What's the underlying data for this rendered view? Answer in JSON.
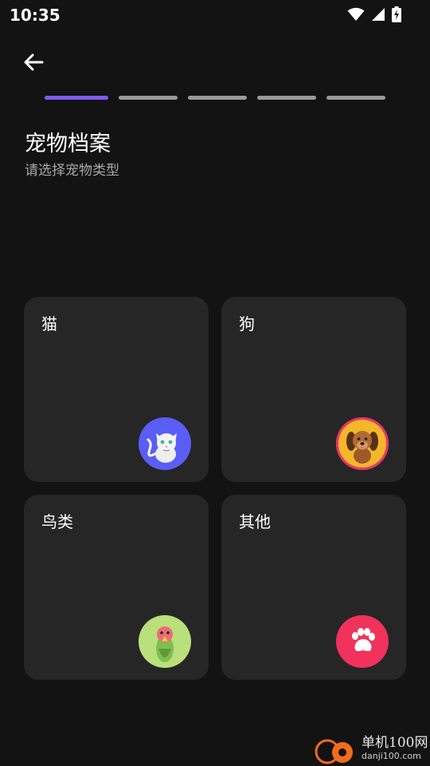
{
  "status_bar": {
    "time": "10:35"
  },
  "header": {
    "title": "宠物档案",
    "subtitle": "请选择宠物类型"
  },
  "progress": {
    "total_steps": 5,
    "current_step": 1
  },
  "pet_types": [
    {
      "label": "猫",
      "icon": "cat-icon",
      "icon_bg": "#5a5ef5"
    },
    {
      "label": "狗",
      "icon": "dog-icon",
      "icon_bg": "#f5b72a"
    },
    {
      "label": "鸟类",
      "icon": "bird-icon",
      "icon_bg": "#b9e07a"
    },
    {
      "label": "其他",
      "icon": "paw-icon",
      "icon_bg": "#f0325c"
    }
  ],
  "watermark": {
    "main": "单机100网",
    "url": "danji100.com"
  },
  "colors": {
    "background": "#131313",
    "card": "#262626",
    "accent": "#7f5af0"
  }
}
